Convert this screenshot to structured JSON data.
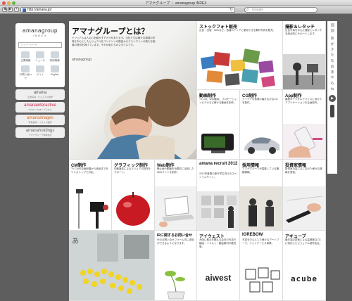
{
  "window": {
    "title": "アマナグループ ｜ amanagroup INDEX"
  },
  "toolbar": {
    "url": "http://amana.jp/",
    "search_placeholder": "Google"
  },
  "sidebar": {
    "logo": "amanagroup",
    "logo_sub": "INDEX",
    "search_placeholder": "フリーワード",
    "icons": [
      {
        "label": "企業情報"
      },
      {
        "label": "ニュース"
      },
      {
        "label": "採用情報"
      },
      {
        "label": "お問い合わせ"
      },
      {
        "label": "サイト"
      },
      {
        "label": "English"
      }
    ],
    "brands": [
      {
        "name": "amana",
        "sub": "広告写真・ビジュアル制作"
      },
      {
        "name": "amanainteractive",
        "sub": "TVCM・WEB・デジタル"
      },
      {
        "name": "amanaimages",
        "sub": "写真素材・イラスト販売"
      },
      {
        "name": "amanaholdings",
        "sub": "アマナグループ持株会社"
      }
    ]
  },
  "hero": {
    "heading": "アマナグループとは？",
    "description": "ビジュアルは人の心を動かすチカラがあります。当社たちは様々な領域の写真を中心としたビジュアルをコンテンツの配信からクライアントの新たな価値の提供を続けています。それが私たちのスタイルです。",
    "logo_line": "amanagroup"
  },
  "tiles": [
    {
      "title": "ストックフォト販売",
      "desc": "広告・出版・Webなど、各種メディアに使用できる素材写真を販売。"
    },
    {
      "title": "撮影＆レタッチ",
      "desc": "広告写真を中心に撮影とレタッチを総合的にサポートします。"
    },
    {
      "title": "動画制作",
      "desc": "TV-CM、Web動画、プロモーションビデオなど様々な動画を制作。"
    },
    {
      "title": "CG制作",
      "desc": "アイデアを表現の幅を広げるCGを制作。"
    },
    {
      "title": "App制作",
      "desc": "最新のデジタルデバイスに向けてアプリケーションを企画制作。"
    },
    {
      "title": "CM制作",
      "desc": "TV-CMの企画段階から納品までをワンストップで対応。"
    },
    {
      "title": "グラフィック制作",
      "desc": "印刷媒体によるビジュアル制作をサポート。"
    },
    {
      "title": "Web制作",
      "desc": "静止画や動画を効果的に活用したWebサイトを制作。"
    },
    {
      "title": "amana recruit 2012",
      "desc": "2012年度春の新卒学生向けのスペシャルサイト。"
    },
    {
      "title": "採用情報",
      "desc": "アマナグループが募集している職種情報。"
    },
    {
      "title": "投資家情報",
      "desc": "投資家の皆さまに向けた様々な情報を発信。"
    },
    {
      "title": "",
      "desc": ""
    },
    {
      "title": "",
      "desc": ""
    },
    {
      "title": "",
      "desc": ""
    },
    {
      "title": "IRに関するお問い合せ",
      "desc": "IRのお問い合せフォーム内に送信ができるようになります。"
    },
    {
      "title": "アイウェスト",
      "desc": "大阪に拠点を構える会社の写真や動画・イラスト・動画素材の販売等。"
    },
    {
      "title": "IGREBOW",
      "desc": "写真を中心とした様々なアートワーク、フォトサービス事業。"
    },
    {
      "title": "アキューブ",
      "desc": "最先端の技術による高精度なCGに特化したビジュアル制作会社。"
    }
  ],
  "logos": {
    "aiwest": "aiwest",
    "acube": "acube"
  },
  "index": {
    "kana": [
      "あ",
      "か",
      "さ",
      "た",
      "な",
      "は",
      "ま",
      "や",
      "ら",
      "わ"
    ]
  }
}
